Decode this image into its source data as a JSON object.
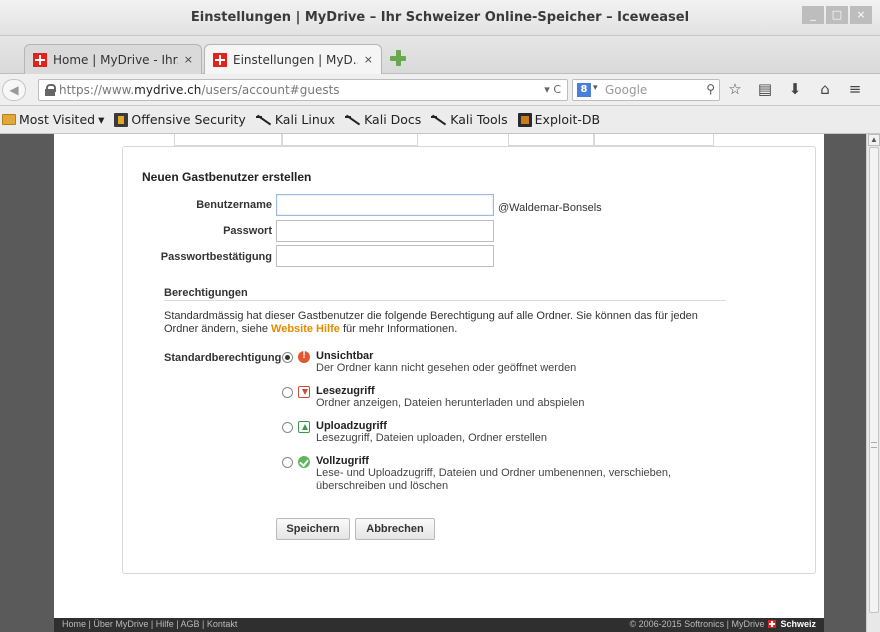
{
  "window": {
    "title": "Einstellungen | MyDrive – Ihr Schweizer Online-Speicher – Iceweasel",
    "minimize": "_",
    "maximize": "□",
    "close": "×"
  },
  "tabs": [
    {
      "label": "Home | MyDrive - Ihr...",
      "close": "×"
    },
    {
      "label": "Einstellungen | MyD...",
      "close": "×"
    }
  ],
  "navbar": {
    "back": "◀",
    "url_prefix": "https://www.",
    "url_domain": "mydrive.ch",
    "url_path": "/users/account#guests",
    "url_controls": "▾ C",
    "search_engine_letter": "8",
    "search_dropdown": "▾",
    "search_placeholder": "Google",
    "search_icon": "magnifier-icon",
    "icons": [
      "☆",
      "▤",
      "⬇",
      "⌂",
      "≡"
    ]
  },
  "bookmarks": [
    {
      "label": "Most Visited",
      "icon": "folder-icon",
      "suffix": "▾"
    },
    {
      "label": "Offensive Security",
      "icon": "offsec-icon"
    },
    {
      "label": "Kali Linux",
      "icon": "kali-icon"
    },
    {
      "label": "Kali Docs",
      "icon": "kali-icon"
    },
    {
      "label": "Kali Tools",
      "icon": "kali-icon"
    },
    {
      "label": "Exploit-DB",
      "icon": "exploitdb-icon"
    }
  ],
  "form": {
    "heading": "Neuen Gastbenutzer erstellen",
    "username_label": "Benutzername",
    "username_value": "",
    "domain_suffix": "@Waldemar-Bonsels",
    "password_label": "Passwort",
    "password_value": "",
    "confirm_label": "Passwortbestätigung",
    "confirm_value": ""
  },
  "permissions": {
    "section_title": "Berechtigungen",
    "desc_part1": "Standardmässig hat dieser Gastbenutzer die folgende Berechtigung auf alle Ordner. Sie können das für jeden Ordner ändern, siehe ",
    "desc_link": "Website Hilfe",
    "desc_part2": " für mehr Informationen.",
    "default_label": "Standardberechtigung",
    "options": [
      {
        "name": "Unsichtbar",
        "desc": "Der Ordner kann nicht gesehen oder geöffnet werden",
        "selected": true,
        "icon": "warning-icon"
      },
      {
        "name": "Lesezugriff",
        "desc": "Ordner anzeigen, Dateien herunterladen und abspielen",
        "selected": false,
        "icon": "download-icon"
      },
      {
        "name": "Uploadzugriff",
        "desc": "Lesezugriff, Dateien uploaden, Ordner erstellen",
        "selected": false,
        "icon": "upload-icon"
      },
      {
        "name": "Vollzugriff",
        "desc": "Lese- und Uploadzugriff, Dateien und Ordner umbenennen, verschieben, überschreiben und löschen",
        "selected": false,
        "icon": "check-icon"
      }
    ]
  },
  "buttons": {
    "save": "Speichern",
    "cancel": "Abbrechen"
  },
  "footer": {
    "links": "Home | Über MyDrive | Hilfe | AGB | Kontakt",
    "copyright": "© 2006-2015 Softronics | MyDrive",
    "brand": "Schweiz"
  },
  "colors": {
    "link_accent": "#e68a00",
    "swiss_red": "#e2231a"
  }
}
